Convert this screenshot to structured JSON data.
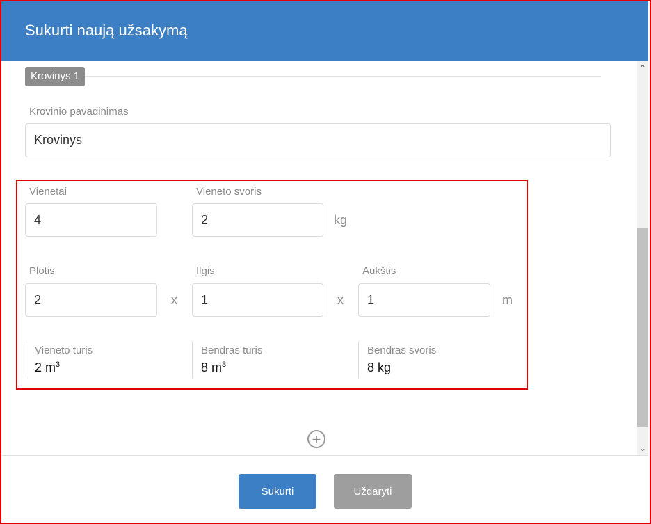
{
  "dialog": {
    "title": "Sukurti naują užsakymą"
  },
  "cargo": {
    "section_label": "Krovinys 1",
    "name_label": "Krovinio pavadinimas",
    "name_value": "Krovinys",
    "units_label": "Vienetai",
    "units_value": "4",
    "unit_weight_label": "Vieneto svoris",
    "unit_weight_value": "2",
    "weight_unit": "kg",
    "width_label": "Plotis",
    "width_value": "2",
    "length_label": "Ilgis",
    "length_value": "1",
    "height_label": "Aukštis",
    "height_value": "1",
    "times_symbol": "x",
    "dimension_unit": "m",
    "stats": [
      {
        "label": "Vieneto tūris",
        "value": "2 m",
        "sup": "3"
      },
      {
        "label": "Bendras tūris",
        "value": "8 m",
        "sup": "3"
      },
      {
        "label": "Bendras svoris",
        "value": "8 kg",
        "sup": ""
      }
    ]
  },
  "add_cargo_icon": "plus-circle-icon",
  "footer": {
    "create_label": "Sukurti",
    "close_label": "Uždaryti"
  },
  "colors": {
    "header": "#3d7fc4",
    "primary_button": "#3d7fc4",
    "secondary_button": "#9e9e9e",
    "highlight_border": "#e30000"
  }
}
